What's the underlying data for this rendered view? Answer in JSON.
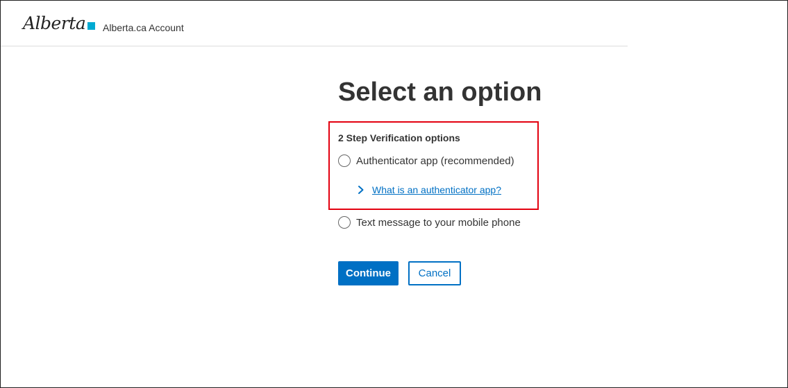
{
  "header": {
    "logo_text": "Alberta",
    "app_name": "Alberta.ca Account"
  },
  "main": {
    "title": "Select an option",
    "fieldset": {
      "legend": "2 Step Verification options",
      "options": [
        {
          "label": "Authenticator app (recommended)",
          "selected": false
        },
        {
          "label": "Text message to your mobile phone",
          "selected": false
        }
      ],
      "details_link": "What is an authenticator app?"
    },
    "buttons": {
      "continue": "Continue",
      "cancel": "Cancel"
    }
  },
  "colors": {
    "primary": "#0070c4",
    "highlight": "#e3000f",
    "logo_mark": "#00aad2"
  },
  "icons": {
    "details_toggle": "chevron-right-icon"
  }
}
